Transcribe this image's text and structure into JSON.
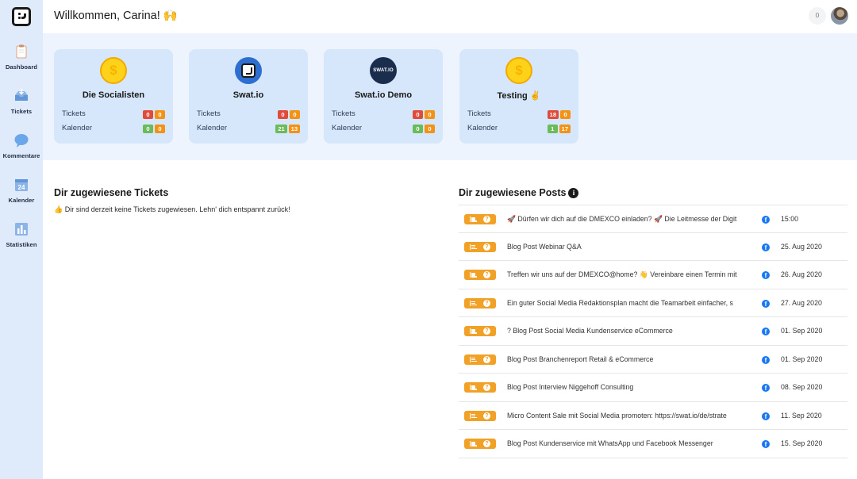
{
  "sidebar": {
    "items": [
      {
        "label": "Dashboard",
        "icon": "clipboard-icon"
      },
      {
        "label": "Tickets",
        "icon": "inbox-icon"
      },
      {
        "label": "Kommentare",
        "icon": "speech-bubble-icon"
      },
      {
        "label": "Kalender",
        "icon": "calendar-icon",
        "calendar_number": "24"
      },
      {
        "label": "Statistiken",
        "icon": "bar-chart-icon"
      }
    ]
  },
  "header": {
    "welcome": "Willkommen, Carina! 🙌",
    "notification_count": "0"
  },
  "projects": [
    {
      "name": "Die Socialisten",
      "icon": "coin-icon",
      "tickets": [
        "0",
        "0"
      ],
      "kalender": [
        "0",
        "0"
      ]
    },
    {
      "name": "Swat.io",
      "icon": "swatio-logo",
      "tickets": [
        "0",
        "0"
      ],
      "kalender": [
        "21",
        "13"
      ]
    },
    {
      "name": "Swat.io Demo",
      "icon": "swatio-demo-logo",
      "logo_text": "SWAT.IO",
      "tickets": [
        "0",
        "0"
      ],
      "kalender": [
        "0",
        "0"
      ]
    },
    {
      "name": "Testing ✌️",
      "icon": "coin-icon",
      "tickets": [
        "18",
        "0"
      ],
      "kalender": [
        "1",
        "17"
      ]
    }
  ],
  "labels": {
    "tickets": "Tickets",
    "kalender": "Kalender",
    "coin_symbol": "$",
    "question_mark": "?",
    "fb_letter": "f",
    "info_letter": "i"
  },
  "tickets_section": {
    "title": "Dir zugewiesene Tickets",
    "empty_message": "👍 Dir sind derzeit keine Tickets zugewiesen. Lehn' dich entspannt zurück!"
  },
  "posts_section": {
    "title": "Dir zugewiesene Posts",
    "posts": [
      {
        "text": "🚀 Dürfen wir dich auf die DMEXCO einladen? 🚀 Die Leitmesse der Digit",
        "date": "15:00"
      },
      {
        "text": "Blog Post Webinar Q&A",
        "date": "25. Aug 2020"
      },
      {
        "text": "Treffen wir uns auf der DMEXCO@home? 👋 Vereinbare einen Termin mit",
        "date": "26. Aug 2020"
      },
      {
        "text": "Ein guter Social Media Redaktionsplan macht die Teamarbeit einfacher, s",
        "date": "27. Aug 2020"
      },
      {
        "text": "? Blog Post Social Media Kundenservice eCommerce",
        "date": "01. Sep 2020"
      },
      {
        "text": "Blog Post Branchenreport Retail & eCommerce",
        "date": "01. Sep 2020"
      },
      {
        "text": "Blog Post Interview Niggehoff Consulting",
        "date": "08. Sep 2020"
      },
      {
        "text": "Micro Content Sale mit Social Media promoten: https://swat.io/de/strate",
        "date": "11. Sep 2020"
      },
      {
        "text": "Blog Post Kundenservice mit WhatsApp und Facebook Messenger",
        "date": "15. Sep 2020"
      }
    ]
  },
  "colors": {
    "sidebar_bg": "#dfeafb",
    "card_bg": "#d6e6fb",
    "badge_red": "#e04b3c",
    "badge_orange": "#f29318",
    "badge_green": "#6cbb5a",
    "status_orange": "#f0a126",
    "facebook_blue": "#1877f2"
  }
}
